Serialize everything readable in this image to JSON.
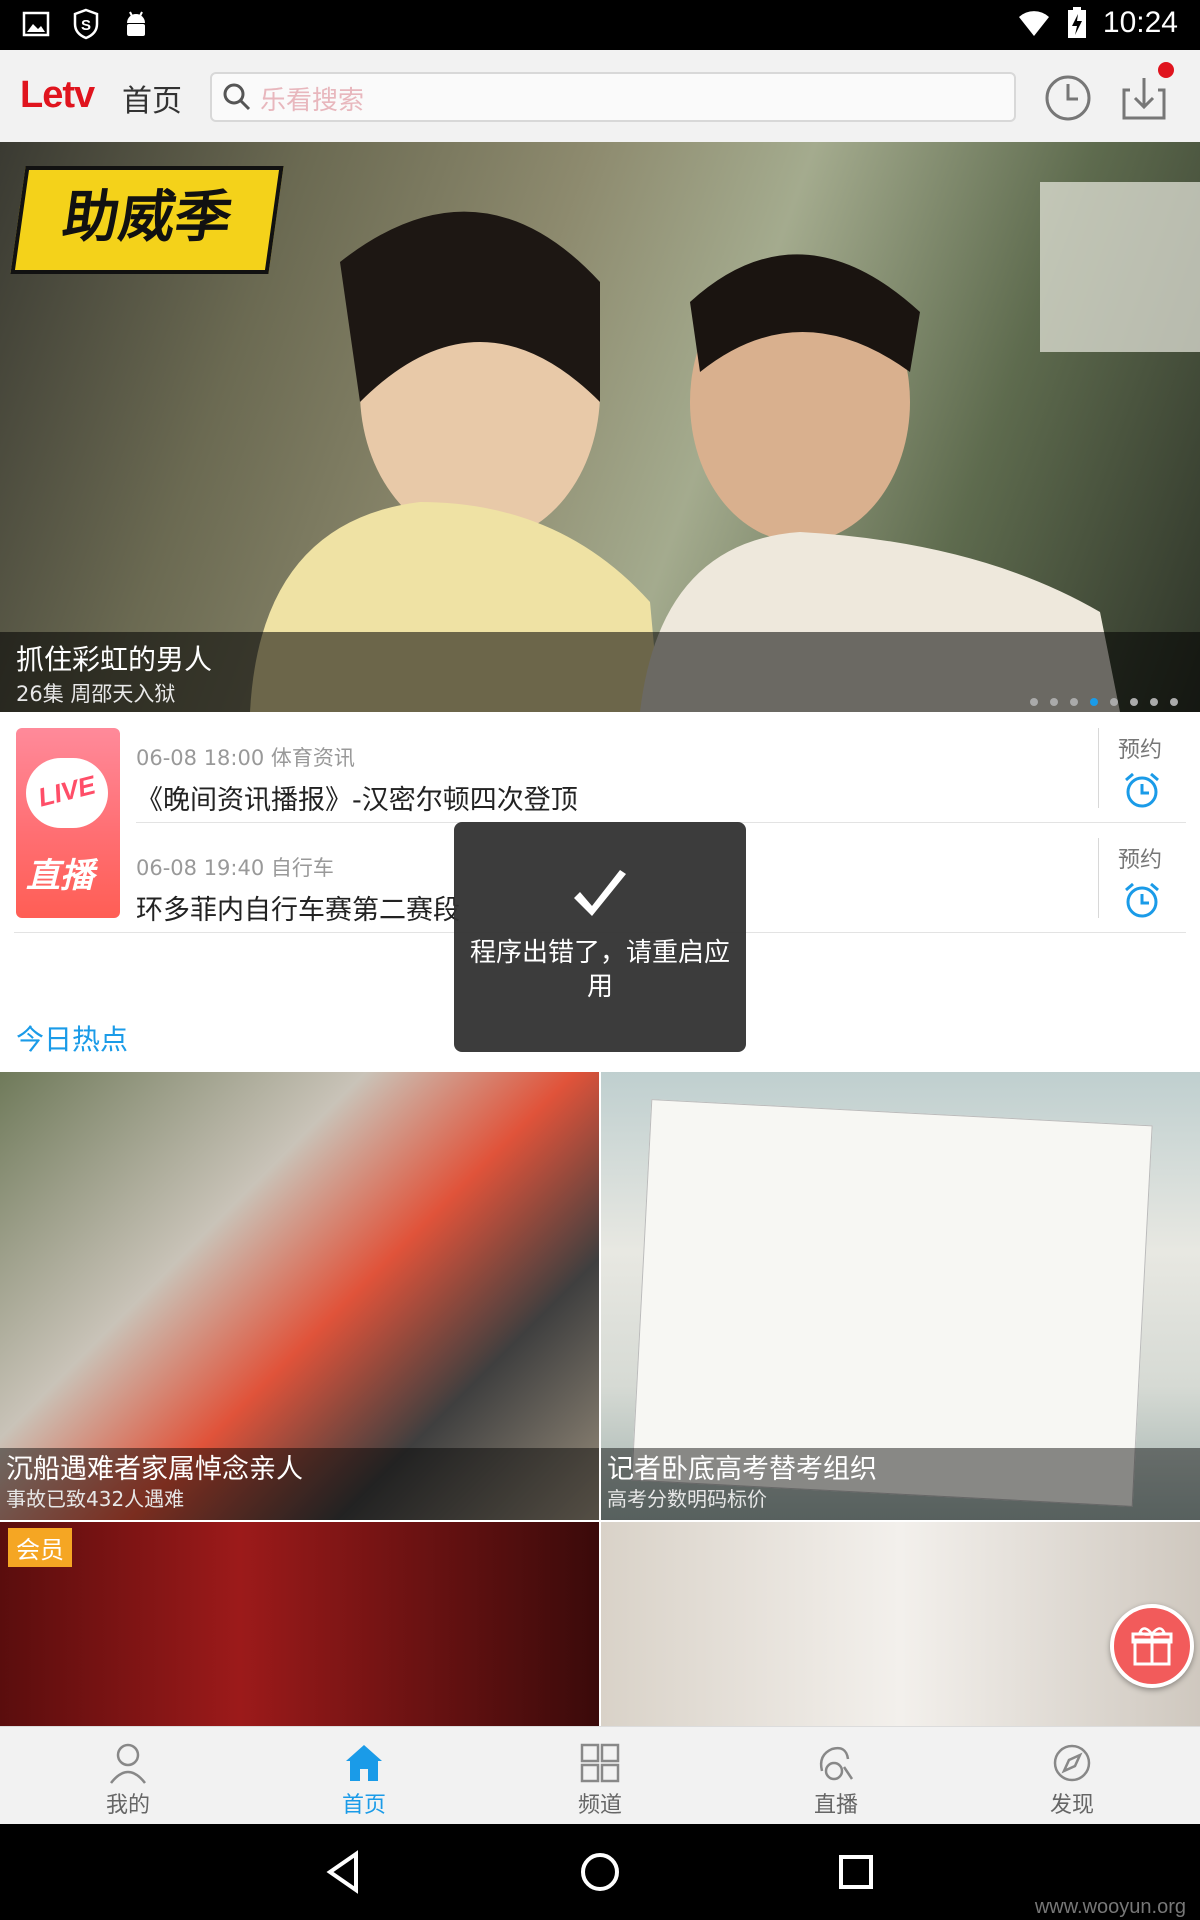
{
  "status_bar": {
    "time": "10:24"
  },
  "header": {
    "logo": "Letv",
    "page_label": "首页",
    "search_placeholder": "乐看搜索"
  },
  "banner": {
    "title": "抓住彩虹的男人",
    "subtitle": "26集 周邵天入狱",
    "badge_text": "助威季",
    "dots_total": 8,
    "dots_active_index": 3
  },
  "live": {
    "badge_en": "LIVE",
    "badge_cn": "直播",
    "items": [
      {
        "meta": "06-08 18:00 体育资讯",
        "title": "《晚间资讯播报》-汉密尔顿四次登顶",
        "action": "预约"
      },
      {
        "meta": "06-08 19:40 自行车",
        "title": "环多菲内自行车赛第二赛段",
        "action": "预约"
      }
    ]
  },
  "section_hot": "今日热点",
  "tiles": [
    {
      "title": "沉船遇难者家属悼念亲人",
      "subtitle": "事故已致432人遇难"
    },
    {
      "title": "记者卧底高考替考组织",
      "subtitle": "高考分数明码标价"
    },
    {
      "badge": "会员"
    },
    {}
  ],
  "toast": {
    "message": "程序出错了，请重启应用"
  },
  "bottom_nav": [
    {
      "label": "我的",
      "icon": "person-icon",
      "active": false
    },
    {
      "label": "首页",
      "icon": "home-icon",
      "active": true
    },
    {
      "label": "频道",
      "icon": "grid-icon",
      "active": false
    },
    {
      "label": "直播",
      "icon": "live-icon",
      "active": false
    },
    {
      "label": "发现",
      "icon": "compass-icon",
      "active": false
    }
  ],
  "watermark": "www.wooyun.org",
  "colors": {
    "brand_red": "#e0141e",
    "accent_blue": "#1a9be8",
    "member_orange": "#f5a623"
  }
}
